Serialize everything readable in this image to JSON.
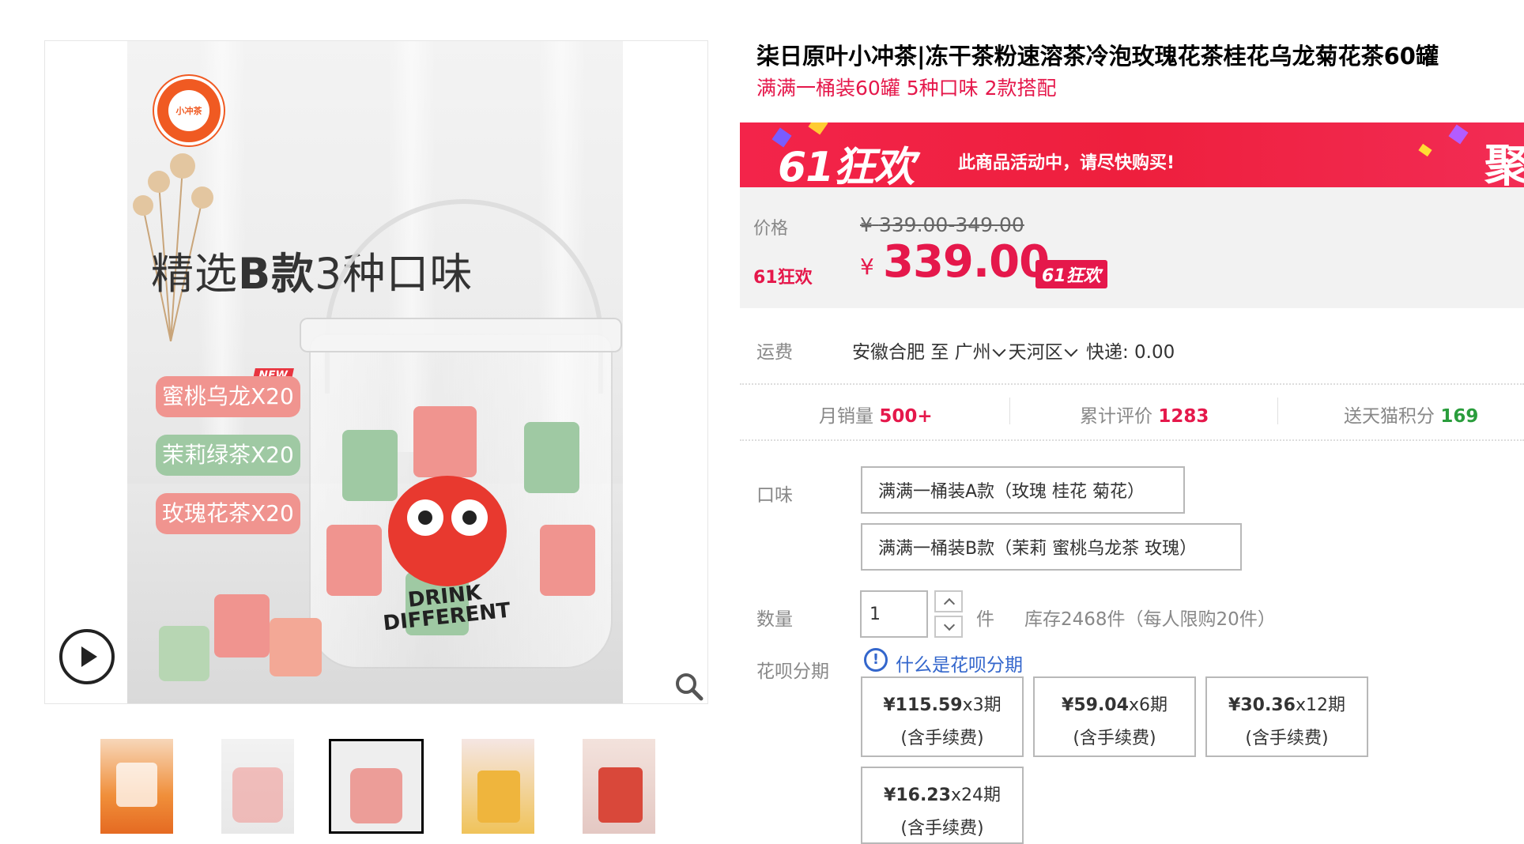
{
  "gallery": {
    "main_image": {
      "logo_text": "小冲茶",
      "headline_prefix": "精选",
      "headline_bold": "B款",
      "headline_suffix": "3种口味",
      "new_tag": "NEW",
      "flavors": [
        {
          "label": "蜜桃乌龙X20",
          "color": "#f0948f"
        },
        {
          "label": "茉莉绿茶X20",
          "color": "#9fc9a3"
        },
        {
          "label": "玫瑰花茶X20",
          "color": "#f0948f"
        }
      ],
      "drink_text_line1": "DRINK",
      "drink_text_line2": "DIFFERENT"
    },
    "thumbnails": [
      {
        "name": "thumbnail-1",
        "active": false
      },
      {
        "name": "thumbnail-2",
        "active": false
      },
      {
        "name": "thumbnail-3",
        "active": true
      },
      {
        "name": "thumbnail-4",
        "active": false
      },
      {
        "name": "thumbnail-5",
        "active": false
      }
    ],
    "icons": {
      "play": "play-icon",
      "zoom": "magnifier-icon"
    }
  },
  "product": {
    "title": "柒日原叶小冲茶|冻干茶粉速溶茶冷泡玫瑰花茶桂花乌龙菊花茶60罐",
    "subtitle": "满满一桶装60罐 5种口味 2款搭配"
  },
  "promo": {
    "logo": "61狂欢",
    "message": "此商品活动中，请尽快购买!",
    "right_text": "聚",
    "colors": {
      "banner": "#f3244a",
      "accent": "#e5184b"
    }
  },
  "price": {
    "price_label": "价格",
    "original_currency": "¥",
    "original_range": "339.00-349.00",
    "promo_label": "61狂欢",
    "currency": "¥",
    "current": "339.00",
    "badge": "61狂欢"
  },
  "shipping": {
    "label": "运费",
    "origin": "安徽合肥",
    "to": "至",
    "city": "广州",
    "district": "天河区",
    "express": "快递: 0.00"
  },
  "stats": {
    "monthly_sales_label": "月销量",
    "monthly_sales_value": "500+",
    "reviews_label": "累计评价",
    "reviews_value": "1283",
    "points_label": "送天猫积分",
    "points_value": "169"
  },
  "flavor_option": {
    "label": "口味",
    "options": [
      "满满一桶装A款（玫瑰 桂花 菊花）",
      "满满一桶装B款（茉莉 蜜桃乌龙茶 玫瑰）"
    ]
  },
  "quantity": {
    "label": "数量",
    "value": "1",
    "unit": "件",
    "stock": "库存2468件",
    "limit": "（每人限购20件）"
  },
  "huabei": {
    "label": "花呗分期",
    "link": "什么是花呗分期",
    "info_glyph": "!",
    "plans": [
      {
        "amount": "¥115.59",
        "periods": "x3期",
        "fee": "(含手续费)"
      },
      {
        "amount": "¥59.04",
        "periods": "x6期",
        "fee": "(含手续费)"
      },
      {
        "amount": "¥30.36",
        "periods": "x12期",
        "fee": "(含手续费)"
      },
      {
        "amount": "¥16.23",
        "periods": "x24期",
        "fee": "(含手续费)"
      }
    ]
  }
}
